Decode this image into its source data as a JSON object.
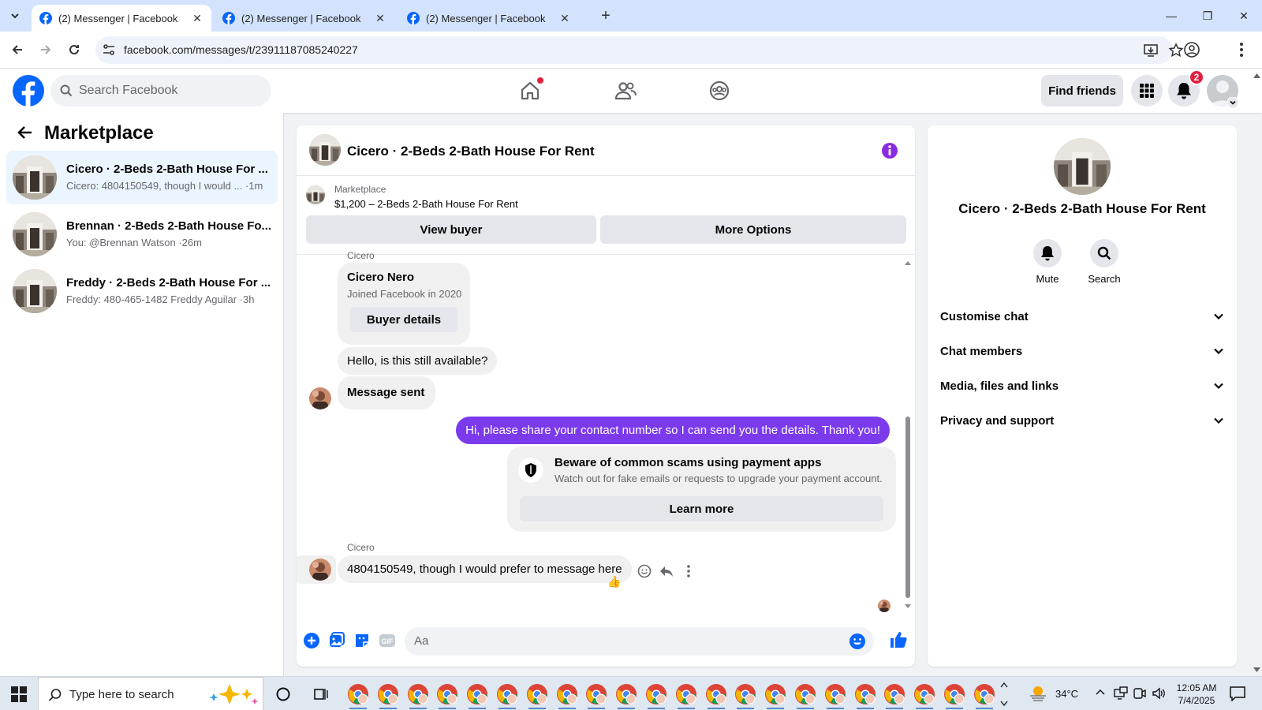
{
  "browser": {
    "tabs": [
      {
        "title": "(2) Messenger | Facebook",
        "active": true
      },
      {
        "title": "(2) Messenger | Facebook",
        "active": false
      },
      {
        "title": "(2) Messenger | Facebook",
        "active": false
      }
    ],
    "url": "facebook.com/messages/t/23911187085240227"
  },
  "header": {
    "search_placeholder": "Search Facebook",
    "find_friends": "Find friends",
    "notification_count": "2"
  },
  "left": {
    "title": "Marketplace",
    "conversations": [
      {
        "name": "Cicero · 2-Beds 2-Bath House For ...",
        "preview": "Cicero: 4804150549, though I would ... ·1m",
        "active": true
      },
      {
        "name": "Brennan · 2-Beds 2-Bath House Fo...",
        "preview": "You: @Brennan Watson ·26m",
        "active": false
      },
      {
        "name": "Freddy · 2-Beds 2-Bath House For ...",
        "preview": "Freddy: 480-465-1482 Freddy Aguilar ·3h",
        "active": false
      }
    ]
  },
  "chat": {
    "title": "Cicero · 2-Beds 2-Bath House For Rent",
    "marketplace_label": "Marketplace",
    "listing": "$1,200 – 2-Beds 2-Bath House For Rent",
    "view_buyer": "View buyer",
    "more_options": "More Options",
    "sender_top": "Cicero",
    "buyer_card": {
      "name": "Cicero Nero",
      "joined": "Joined Facebook in 2020",
      "button": "Buyer details"
    },
    "msg1": "Hello, is this still available?",
    "msg2": "Message sent",
    "my_msg": "Hi, please share your contact number so I can send you the details. Thank you!",
    "scam": {
      "title": "Beware of common scams using payment apps",
      "body": "Watch out for fake emails or requests to upgrade your payment account.",
      "button": "Learn more"
    },
    "sender_bottom": "Cicero",
    "last_msg": "4804150549, though I would prefer to message here",
    "reaction": "👍",
    "composer_placeholder": "Aa"
  },
  "right": {
    "name": "Cicero · 2-Beds 2-Bath House For Rent",
    "mute": "Mute",
    "search": "Search",
    "rows": [
      "Customise chat",
      "Chat members",
      "Media, files and links",
      "Privacy and support"
    ]
  },
  "taskbar": {
    "search_placeholder": "Type here to search",
    "temperature": "34°C",
    "time": "12:05 AM",
    "date": "7/4/2025"
  },
  "colors": {
    "facebook_blue": "#0866ff",
    "my_bubble": "#7c3aed",
    "badge_red": "#e41e3f"
  }
}
